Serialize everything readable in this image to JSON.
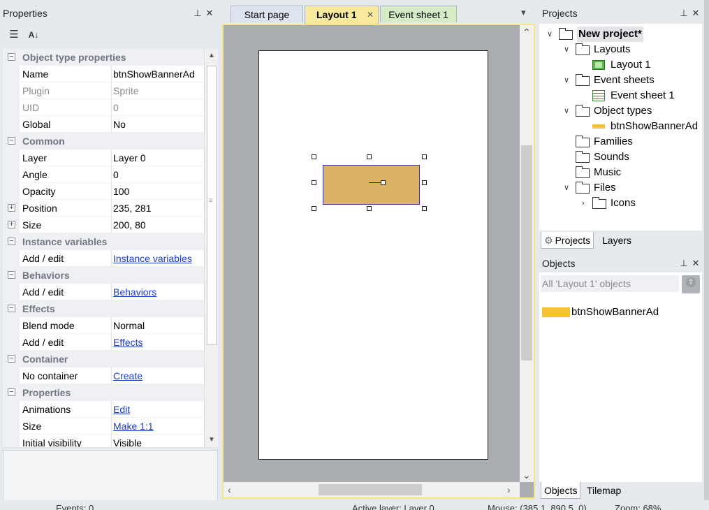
{
  "properties_panel": {
    "title": "Properties",
    "pin_glyph": "⌂",
    "close_glyph": "✕",
    "toolbar": {
      "categorized_icon": "categorized-icon",
      "sort_az_icon": "sort-az-icon"
    },
    "rows": [
      {
        "type": "cat",
        "name": "Object type properties",
        "toggle": "−"
      },
      {
        "type": "prop",
        "name": "Name",
        "value": "btnShowBannerAd"
      },
      {
        "type": "dim",
        "name": "Plugin",
        "value": "Sprite"
      },
      {
        "type": "dim",
        "name": "UID",
        "value": "0"
      },
      {
        "type": "prop",
        "name": "Global",
        "value": "No"
      },
      {
        "type": "cat",
        "name": "Common",
        "toggle": "−"
      },
      {
        "type": "prop",
        "name": "Layer",
        "value": "Layer 0"
      },
      {
        "type": "prop",
        "name": "Angle",
        "value": "0"
      },
      {
        "type": "prop",
        "name": "Opacity",
        "value": "100"
      },
      {
        "type": "expand",
        "name": "Position",
        "value": "235, 281",
        "toggle": "+"
      },
      {
        "type": "expand",
        "name": "Size",
        "value": "200, 80",
        "toggle": "+"
      },
      {
        "type": "cat",
        "name": "Instance variables",
        "toggle": "−"
      },
      {
        "type": "link",
        "name": "Add / edit",
        "value": "Instance variables"
      },
      {
        "type": "cat",
        "name": "Behaviors",
        "toggle": "−"
      },
      {
        "type": "link",
        "name": "Add / edit",
        "value": "Behaviors"
      },
      {
        "type": "cat",
        "name": "Effects",
        "toggle": "−"
      },
      {
        "type": "prop",
        "name": "Blend mode",
        "value": "Normal"
      },
      {
        "type": "link",
        "name": "Add / edit",
        "value": "Effects"
      },
      {
        "type": "cat",
        "name": "Container",
        "toggle": "−"
      },
      {
        "type": "link",
        "name": "No container",
        "value": "Create"
      },
      {
        "type": "cat",
        "name": "Properties",
        "toggle": "−"
      },
      {
        "type": "link",
        "name": "Animations",
        "value": "Edit"
      },
      {
        "type": "link",
        "name": "Size",
        "value": "Make 1:1"
      },
      {
        "type": "prop",
        "name": "Initial visibility",
        "value": "Visible"
      }
    ]
  },
  "editor": {
    "tabs": [
      {
        "label": "Start page",
        "active": false,
        "color": "#dde4ef"
      },
      {
        "label": "Layout 1",
        "active": true,
        "color": "#f8ea9c",
        "close": "✕"
      },
      {
        "label": "Event sheet 1",
        "active": false,
        "color": "#d6ecc6"
      }
    ],
    "overflow_glyph": "▾",
    "colors": {
      "canvas_bg": "#a9adb2",
      "sprite_fill": "#dcb365",
      "active_border": "#f3e48a"
    }
  },
  "projects_panel": {
    "title": "Projects",
    "tree": [
      {
        "label": "New project*",
        "bold": true,
        "icon": "folder-open-icon",
        "chevron": "∨",
        "level": 0
      },
      {
        "label": "Layouts",
        "icon": "folder-icon",
        "chevron": "∨",
        "level": 1
      },
      {
        "label": "Layout 1",
        "icon": "layout-icon",
        "chevron": "",
        "level": 2
      },
      {
        "label": "Event sheets",
        "icon": "folder-icon",
        "chevron": "∨",
        "level": 1
      },
      {
        "label": "Event sheet 1",
        "icon": "event-sheet-icon",
        "chevron": "",
        "level": 2
      },
      {
        "label": "Object types",
        "icon": "folder-icon",
        "chevron": "∨",
        "level": 1
      },
      {
        "label": "btnShowBannerAd",
        "icon": "sprite-swatch-icon",
        "chevron": "",
        "level": 2
      },
      {
        "label": "Families",
        "icon": "folder-icon",
        "chevron": "",
        "level": 1
      },
      {
        "label": "Sounds",
        "icon": "folder-icon",
        "chevron": "",
        "level": 1
      },
      {
        "label": "Music",
        "icon": "folder-icon",
        "chevron": "",
        "level": 1
      },
      {
        "label": "Files",
        "icon": "folder-icon",
        "chevron": "∨",
        "level": 1
      },
      {
        "label": "Icons",
        "icon": "folder-icon",
        "chevron": "›",
        "level": 2
      }
    ],
    "tabs": [
      {
        "label": "Projects",
        "active": true
      },
      {
        "label": "Layers",
        "active": false
      }
    ]
  },
  "objects_panel": {
    "title": "Objects",
    "filter_placeholder": "All 'Layout 1' objects",
    "items": [
      {
        "label": "btnShowBannerAd",
        "swatch": "#f3c236"
      }
    ],
    "tabs": [
      {
        "label": "Objects",
        "active": true
      },
      {
        "label": "Tilemap",
        "active": false
      }
    ]
  },
  "status_bar": {
    "events": "Events: 0",
    "active_layer": "Active layer: Layer 0",
    "mouse": "Mouse: (385.1, 890.5, 0)",
    "zoom": "Zoom: 68%"
  }
}
